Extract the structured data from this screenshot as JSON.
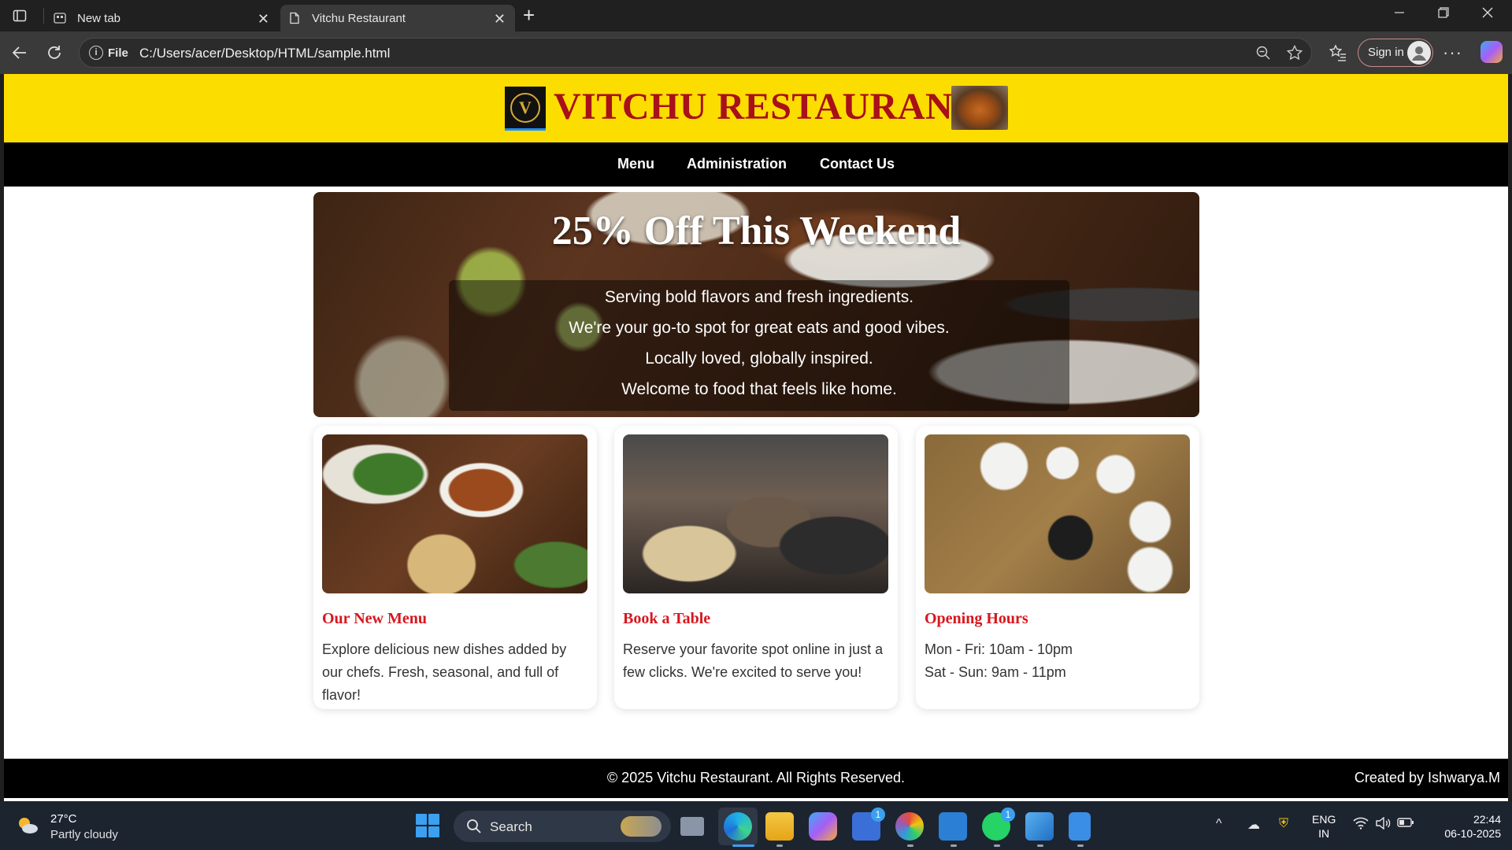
{
  "browser": {
    "tabs": [
      {
        "title": "New tab",
        "active": false
      },
      {
        "title": "Vitchu Restaurant",
        "active": true
      }
    ],
    "address": {
      "scheme_label": "File",
      "url": "C:/Users/acer/Desktop/HTML/sample.html"
    },
    "sign_in_label": "Sign in",
    "icons": {
      "tab_actions": "tab-actions-icon",
      "new_tab": "plus-icon",
      "back": "back-arrow-icon",
      "refresh": "refresh-icon",
      "zoom": "zoom-out-icon",
      "favorite": "star-icon",
      "favorites": "favorites-icon",
      "more": "more-icon",
      "copilot": "copilot-icon"
    }
  },
  "site": {
    "title": "VITCHU RESTAURANT",
    "logo_letter": "V",
    "nav": [
      "Menu",
      "Administration",
      "Contact Us"
    ],
    "hero": {
      "title": "25% Off This Weekend",
      "lines": [
        "Serving bold flavors and fresh ingredients.",
        "We're your go-to spot for great eats and good vibes.",
        "Locally loved, globally inspired.",
        "Welcome to food that feels like home."
      ]
    },
    "cards": [
      {
        "title": "Our New Menu",
        "text": "Explore delicious new dishes added by our chefs. Fresh, seasonal, and full of flavor!"
      },
      {
        "title": "Book a Table",
        "text": "Reserve your favorite spot online in just a few clicks. We're excited to serve you!"
      },
      {
        "title": "Opening Hours",
        "lines": [
          "Mon - Fri: 10am - 10pm",
          "Sat - Sun: 9am - 11pm"
        ]
      }
    ],
    "footer": {
      "copyright": "© 2025 Vitchu Restaurant. All Rights Reserved.",
      "credit": "Created by Ishwarya.M"
    },
    "colors": {
      "header_bg": "#fcdd00",
      "title_color": "#a8101a",
      "card_title": "#d7171f",
      "nav_bg": "#000000"
    }
  },
  "taskbar": {
    "weather": {
      "temp": "27°C",
      "desc": "Partly cloudy"
    },
    "search_label": "Search",
    "badges": {
      "store": "1",
      "whatsapp": "1"
    },
    "language": {
      "line1": "ENG",
      "line2": "IN"
    },
    "clock": {
      "time": "22:44",
      "date": "06-10-2025"
    }
  }
}
